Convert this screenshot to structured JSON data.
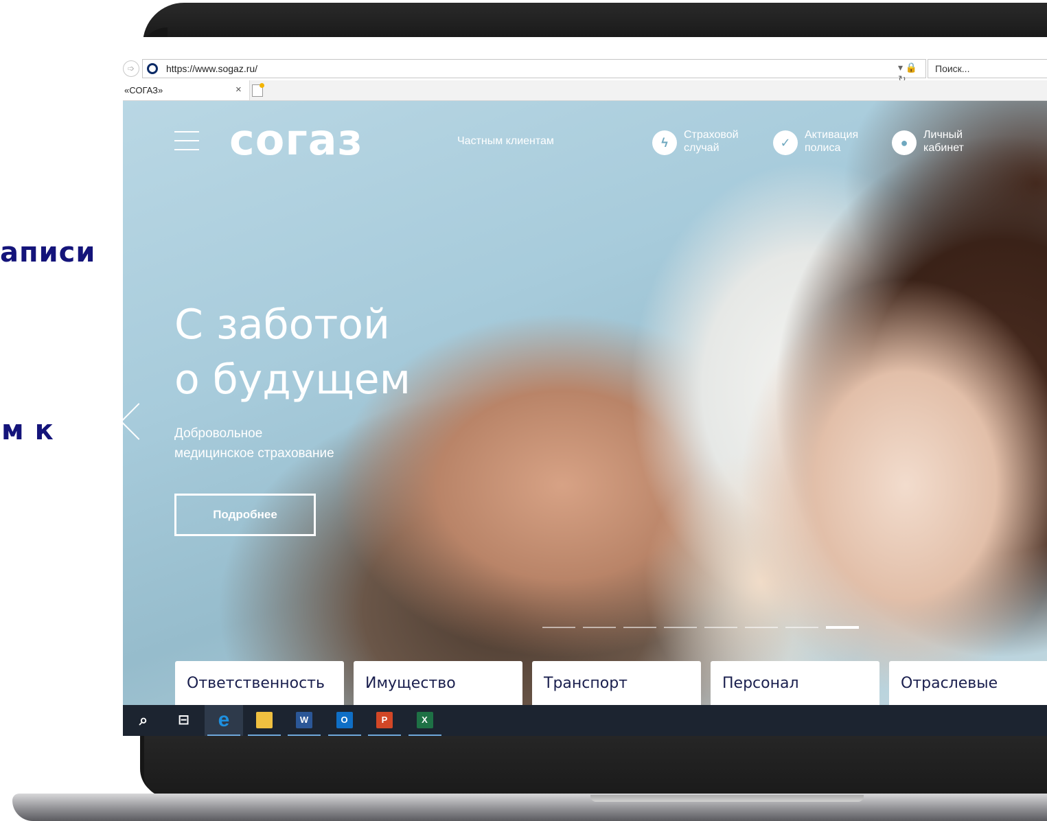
{
  "side_text": {
    "line1": "аписи",
    "line2": "м к"
  },
  "browser": {
    "url": "https://www.sogaz.ru/",
    "address_controls": "▾ 🔒 ↻",
    "search_placeholder": "Поиск...",
    "tab_title": "«СОГАЗ»",
    "tab_close": "×"
  },
  "site": {
    "logo": "согаз",
    "top_link": "Частным клиентам",
    "utility": [
      {
        "line1": "Страховой",
        "line2": "случай",
        "icon": "lightning-shield-icon"
      },
      {
        "line1": "Активация",
        "line2": "полиса",
        "icon": "check-shield-icon"
      },
      {
        "line1": "Личный",
        "line2": "кабинет",
        "icon": "user-shield-icon"
      }
    ],
    "headline_line1": "С заботой",
    "headline_line2": "о будущем",
    "sub_line1": "Добровольное",
    "sub_line2": "медицинское страхование",
    "cta": "Подробнее",
    "slides_total": 8,
    "slide_active": 8,
    "categories": [
      "Ответственность",
      "Имущество",
      "Транспорт",
      "Персонал",
      "Отраслевые"
    ]
  },
  "taskbar": {
    "items": [
      {
        "name": "search-icon",
        "glyph": "⌕"
      },
      {
        "name": "task-view-icon",
        "glyph": "⊟"
      },
      {
        "name": "internet-explorer-icon",
        "glyph": "e"
      },
      {
        "name": "file-explorer-icon",
        "glyph": "▬"
      },
      {
        "name": "word-icon",
        "glyph": "W"
      },
      {
        "name": "outlook-icon",
        "glyph": "O"
      },
      {
        "name": "powerpoint-icon",
        "glyph": "P"
      },
      {
        "name": "excel-icon",
        "glyph": "X"
      }
    ]
  },
  "colors": {
    "side_text": "#14147a",
    "brand_text": "#ffffff",
    "category_text": "#1a1f4e",
    "taskbar": "#1c2430",
    "word": "#2b5797",
    "outlook": "#0f6fc6",
    "powerpoint": "#d24726",
    "excel": "#1e7145",
    "explorer": "#f0c040",
    "ie": "#1e90e0"
  }
}
